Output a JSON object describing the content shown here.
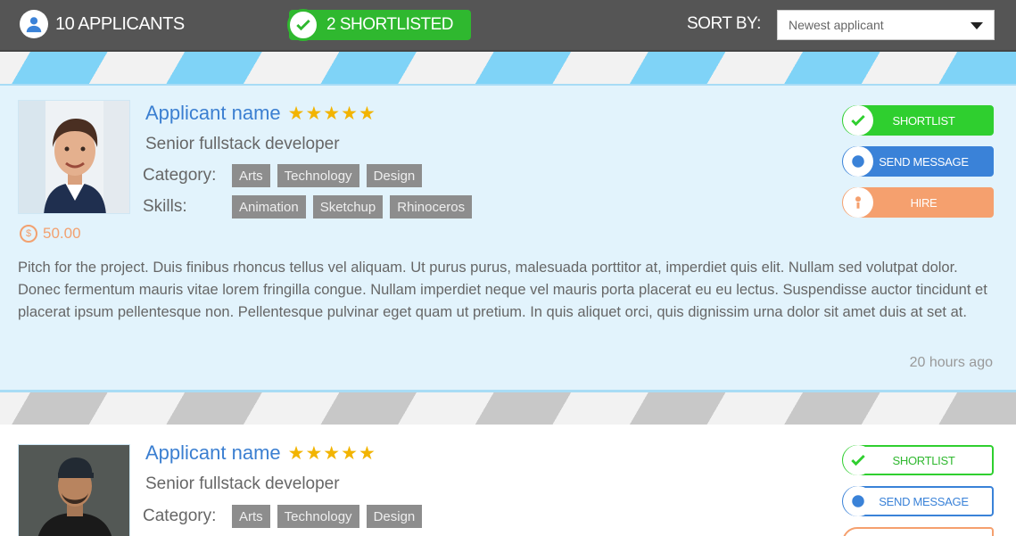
{
  "topbar": {
    "applicants_label": "10 APPLICANTS",
    "shortlisted_label": "2 SHORTLISTED",
    "sort_label": "SORT BY:",
    "sort_value": "Newest applicant"
  },
  "colors": {
    "topbar": "#555555",
    "shortlisted": "#2fb82f",
    "name": "#3b7fd1",
    "stars": "#f2b400",
    "message": "#3a82d8",
    "hire": "#f5a06e",
    "card_highlight": "#e2f3fc"
  },
  "applicants": [
    {
      "name": "Applicant name",
      "stars": "★★★★★",
      "role": "Senior fullstack developer",
      "category_label": "Category:",
      "categories": [
        "Arts",
        "Technology",
        "Design"
      ],
      "skills_label": "Skills:",
      "skills": [
        "Animation",
        "Sketchup",
        "Rhinoceros"
      ],
      "price": "50.00",
      "pitch": "Pitch for the project. Duis finibus rhoncus tellus vel  aliquam. Ut purus purus, malesuada porttitor at, imperdiet quis elit. Nullam sed volutpat dolor. Donec fermentum mauris vitae lorem fringilla congue. Nullam imperdiet neque vel mauris porta placerat eu eu lectus. Suspendisse auctor tincidunt et placerat ipsum pellentesque non. Pellentesque pulvinar eget quam ut pretium. In quis aliquet orci, quis dignissim urna dolor sit amet duis at set at.",
      "time": "20 hours ago",
      "actions": {
        "shortlist": "SHORTLIST",
        "message": "SEND MESSAGE",
        "hire": "HIRE"
      }
    },
    {
      "name": "Applicant name",
      "stars": "★★★★★",
      "role": "Senior fullstack developer",
      "category_label": "Category:",
      "categories": [
        "Arts",
        "Technology",
        "Design"
      ],
      "actions": {
        "shortlist": "SHORTLIST",
        "message": "SEND MESSAGE"
      }
    }
  ]
}
